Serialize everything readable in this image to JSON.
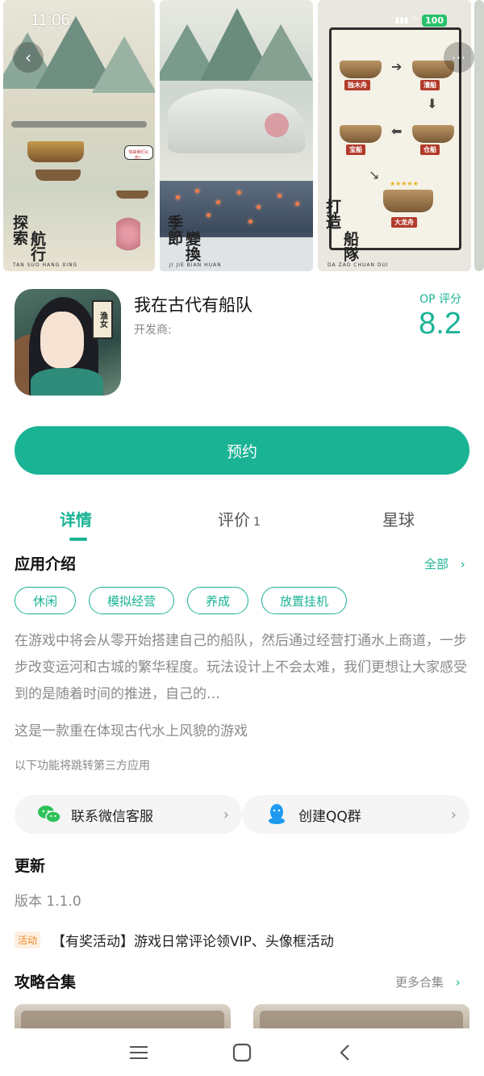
{
  "status": {
    "time": "11:06",
    "battery": "100"
  },
  "gallery": {
    "shot1": {
      "title": "探索航行",
      "title_col1": "探索",
      "title_col2": "航行",
      "subtitle": "TAN SUO HANG XING",
      "bubble": "快来我们公司！"
    },
    "shot2": {
      "title_col1": "季節",
      "title_col2": "變換",
      "subtitle": "JI JIE BIAN HUAN"
    },
    "shot3": {
      "title_col1": "打造",
      "title_col2": "船隊",
      "subtitle": "DA ZAO CHUAN DUI",
      "boats": [
        "独木舟",
        "漕船",
        "宝船",
        "仓船",
        "大龙舟"
      ]
    }
  },
  "app": {
    "title": "我在古代有船队",
    "developer_label": "开发商:",
    "icon_badge": "渔女",
    "score_label": "OP 评分",
    "score_value": "8.2"
  },
  "reserve_button": "预约",
  "tabs": [
    {
      "label": "详情"
    },
    {
      "label": "评价",
      "count": "1"
    },
    {
      "label": "星球"
    }
  ],
  "intro": {
    "title": "应用介绍",
    "all_label": "全部",
    "tags": [
      "休闲",
      "模拟经营",
      "养成",
      "放置挂机"
    ],
    "description": "在游戏中将会从零开始搭建自己的船队，然后通过经营打通水上商道，一步步改变运河和古城的繁华程度。玩法设计上不会太难，我们更想让大家感受到的是随着时间的推进，自己的…",
    "tagline": "这是一款重在体现古代水上风貌的游戏",
    "third_party_note": "以下功能将跳转第三方应用"
  },
  "contacts": [
    {
      "label": "联系微信客服",
      "icon": "wechat-icon",
      "color": "#2ec25b"
    },
    {
      "label": "创建QQ群",
      "icon": "qq-icon",
      "color": "#1e9bf0"
    }
  ],
  "update": {
    "title": "更新",
    "version": "版本 1.1.0",
    "activity_badge": "活动",
    "activity_text": "【有奖活动】游戏日常评论领VIP、头像框活动"
  },
  "guides": {
    "title": "攻略合集",
    "more_label": "更多合集"
  },
  "colors": {
    "accent": "#1ab394",
    "activity": "#f08a24"
  }
}
